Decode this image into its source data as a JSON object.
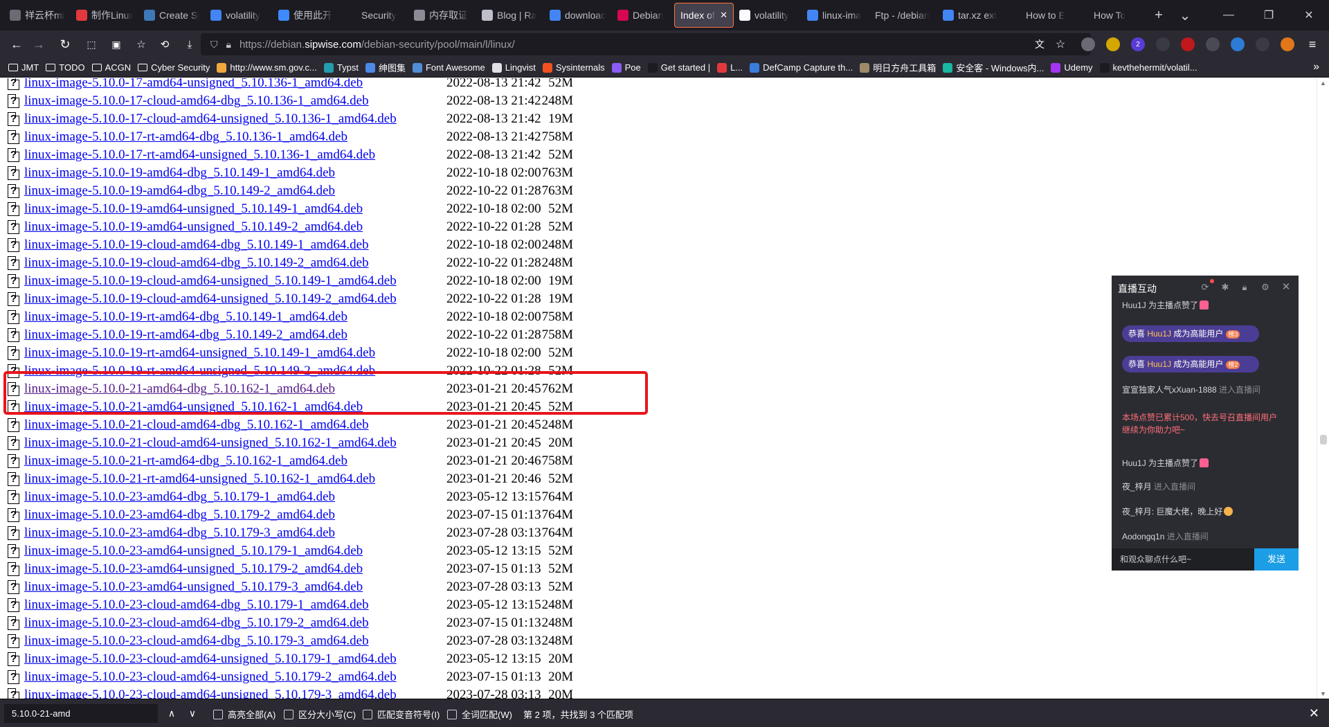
{
  "tabs": [
    {
      "label": "祥云杯mis",
      "icon": "ctf-icon",
      "color": "#6b6b75",
      "active": false
    },
    {
      "label": "制作Linux",
      "icon": "csdn-icon",
      "color": "#e4393c",
      "active": false
    },
    {
      "label": "Create Sp",
      "icon": "wordpress-icon",
      "color": "#3e79b7",
      "active": false
    },
    {
      "label": "volatility",
      "icon": "google-icon",
      "color": "#4285f4",
      "active": false
    },
    {
      "label": "使用此开",
      "icon": "doc-icon",
      "color": "#3d8bfd",
      "active": false
    },
    {
      "label": "Security",
      "icon": "bing-icon",
      "color": "#1c1b22",
      "active": false
    },
    {
      "label": "内存取证",
      "icon": "image-icon",
      "color": "#8c8c96",
      "active": false
    },
    {
      "label": "Blog | Ra",
      "icon": "blog-icon",
      "color": "#bfbfc9",
      "active": false
    },
    {
      "label": "downloac",
      "icon": "google-icon",
      "color": "#4285f4",
      "active": false
    },
    {
      "label": "Debian",
      "icon": "debian-icon",
      "color": "#d70751",
      "active": false
    },
    {
      "label": "Index of /d",
      "icon": "",
      "color": "",
      "active": true
    },
    {
      "label": "volatility",
      "icon": "github-icon",
      "color": "#fbfbfe",
      "active": false
    },
    {
      "label": "linux-ima",
      "icon": "google-icon",
      "color": "#4285f4",
      "active": false
    },
    {
      "label": "Ftp - /debian",
      "icon": "",
      "color": "",
      "active": false
    },
    {
      "label": "tar.xz ext",
      "icon": "google-icon",
      "color": "#4285f4",
      "active": false
    },
    {
      "label": "How to E",
      "icon": "site-icon",
      "color": "#1c1b22",
      "active": false
    },
    {
      "label": "How To",
      "icon": "site-icon",
      "color": "#1c1b22",
      "active": false
    }
  ],
  "address": {
    "prefix": "https://debian.",
    "host": "sipwise.com",
    "path": "/debian-security/pool/main/l/linux/"
  },
  "bookmarks": [
    {
      "label": "JMT",
      "icon": "folder"
    },
    {
      "label": "TODO",
      "icon": "folder"
    },
    {
      "label": "ACGN",
      "icon": "folder"
    },
    {
      "label": "Cyber Security",
      "icon": "folder"
    },
    {
      "label": "http://www.sm.gov.c...",
      "icon": "site",
      "color": "#f2a93b"
    },
    {
      "label": "Typst",
      "icon": "site",
      "color": "#239dad"
    },
    {
      "label": "绅图集",
      "icon": "site",
      "color": "#4d8ae8"
    },
    {
      "label": "Font Awesome",
      "icon": "site",
      "color": "#528dd7"
    },
    {
      "label": "Lingvist",
      "icon": "site",
      "color": "#e0e0e6"
    },
    {
      "label": "Sysinternals",
      "icon": "site",
      "color": "#f25022"
    },
    {
      "label": "Poe",
      "icon": "site",
      "color": "#8b5cf6"
    },
    {
      "label": "Get started |",
      "icon": "site",
      "color": "#1c1b22"
    },
    {
      "label": "L...",
      "icon": "site",
      "color": "#e4393c"
    },
    {
      "label": "DefCamp Capture th...",
      "icon": "site",
      "color": "#3b7ddd"
    },
    {
      "label": "明日方舟工具箱",
      "icon": "site",
      "color": "#9c8a6a"
    },
    {
      "label": "安全客 - Windows内...",
      "icon": "site",
      "color": "#19b6a0"
    },
    {
      "label": "Udemy",
      "icon": "site",
      "color": "#a435f0"
    },
    {
      "label": "kevthehermit/volatil...",
      "icon": "site",
      "color": "#1c1b22"
    }
  ],
  "listing": [
    {
      "name": "linux-image-5.10.0-17-amd64-unsigned_5.10.136-1_amd64.deb",
      "date": "2022-08-13 21:42",
      "size": "52M"
    },
    {
      "name": "linux-image-5.10.0-17-cloud-amd64-dbg_5.10.136-1_amd64.deb",
      "date": "2022-08-13 21:42",
      "size": "248M"
    },
    {
      "name": "linux-image-5.10.0-17-cloud-amd64-unsigned_5.10.136-1_amd64.deb",
      "date": "2022-08-13 21:42",
      "size": "19M"
    },
    {
      "name": "linux-image-5.10.0-17-rt-amd64-dbg_5.10.136-1_amd64.deb",
      "date": "2022-08-13 21:42",
      "size": "758M"
    },
    {
      "name": "linux-image-5.10.0-17-rt-amd64-unsigned_5.10.136-1_amd64.deb",
      "date": "2022-08-13 21:42",
      "size": "52M"
    },
    {
      "name": "linux-image-5.10.0-19-amd64-dbg_5.10.149-1_amd64.deb",
      "date": "2022-10-18 02:00",
      "size": "763M"
    },
    {
      "name": "linux-image-5.10.0-19-amd64-dbg_5.10.149-2_amd64.deb",
      "date": "2022-10-22 01:28",
      "size": "763M"
    },
    {
      "name": "linux-image-5.10.0-19-amd64-unsigned_5.10.149-1_amd64.deb",
      "date": "2022-10-18 02:00",
      "size": "52M"
    },
    {
      "name": "linux-image-5.10.0-19-amd64-unsigned_5.10.149-2_amd64.deb",
      "date": "2022-10-22 01:28",
      "size": "52M"
    },
    {
      "name": "linux-image-5.10.0-19-cloud-amd64-dbg_5.10.149-1_amd64.deb",
      "date": "2022-10-18 02:00",
      "size": "248M"
    },
    {
      "name": "linux-image-5.10.0-19-cloud-amd64-dbg_5.10.149-2_amd64.deb",
      "date": "2022-10-22 01:28",
      "size": "248M"
    },
    {
      "name": "linux-image-5.10.0-19-cloud-amd64-unsigned_5.10.149-1_amd64.deb",
      "date": "2022-10-18 02:00",
      "size": "19M"
    },
    {
      "name": "linux-image-5.10.0-19-cloud-amd64-unsigned_5.10.149-2_amd64.deb",
      "date": "2022-10-22 01:28",
      "size": "19M"
    },
    {
      "name": "linux-image-5.10.0-19-rt-amd64-dbg_5.10.149-1_amd64.deb",
      "date": "2022-10-18 02:00",
      "size": "758M"
    },
    {
      "name": "linux-image-5.10.0-19-rt-amd64-dbg_5.10.149-2_amd64.deb",
      "date": "2022-10-22 01:28",
      "size": "758M"
    },
    {
      "name": "linux-image-5.10.0-19-rt-amd64-unsigned_5.10.149-1_amd64.deb",
      "date": "2022-10-18 02:00",
      "size": "52M"
    },
    {
      "name": "linux-image-5.10.0-19-rt-amd64-unsigned_5.10.149-2_amd64.deb",
      "date": "2022-10-22 01:28",
      "size": "52M"
    },
    {
      "name": "linux-image-5.10.0-21-amd64-dbg_5.10.162-1_amd64.deb",
      "date": "2023-01-21 20:45",
      "size": "762M",
      "visited": true
    },
    {
      "name": "linux-image-5.10.0-21-amd64-unsigned_5.10.162-1_amd64.deb",
      "date": "2023-01-21 20:45",
      "size": "52M"
    },
    {
      "name": "linux-image-5.10.0-21-cloud-amd64-dbg_5.10.162-1_amd64.deb",
      "date": "2023-01-21 20:45",
      "size": "248M"
    },
    {
      "name": "linux-image-5.10.0-21-cloud-amd64-unsigned_5.10.162-1_amd64.deb",
      "date": "2023-01-21 20:45",
      "size": "20M"
    },
    {
      "name": "linux-image-5.10.0-21-rt-amd64-dbg_5.10.162-1_amd64.deb",
      "date": "2023-01-21 20:46",
      "size": "758M"
    },
    {
      "name": "linux-image-5.10.0-21-rt-amd64-unsigned_5.10.162-1_amd64.deb",
      "date": "2023-01-21 20:46",
      "size": "52M"
    },
    {
      "name": "linux-image-5.10.0-23-amd64-dbg_5.10.179-1_amd64.deb",
      "date": "2023-05-12 13:15",
      "size": "764M"
    },
    {
      "name": "linux-image-5.10.0-23-amd64-dbg_5.10.179-2_amd64.deb",
      "date": "2023-07-15 01:13",
      "size": "764M"
    },
    {
      "name": "linux-image-5.10.0-23-amd64-dbg_5.10.179-3_amd64.deb",
      "date": "2023-07-28 03:13",
      "size": "764M"
    },
    {
      "name": "linux-image-5.10.0-23-amd64-unsigned_5.10.179-1_amd64.deb",
      "date": "2023-05-12 13:15",
      "size": "52M"
    },
    {
      "name": "linux-image-5.10.0-23-amd64-unsigned_5.10.179-2_amd64.deb",
      "date": "2023-07-15 01:13",
      "size": "52M"
    },
    {
      "name": "linux-image-5.10.0-23-amd64-unsigned_5.10.179-3_amd64.deb",
      "date": "2023-07-28 03:13",
      "size": "52M"
    },
    {
      "name": "linux-image-5.10.0-23-cloud-amd64-dbg_5.10.179-1_amd64.deb",
      "date": "2023-05-12 13:15",
      "size": "248M"
    },
    {
      "name": "linux-image-5.10.0-23-cloud-amd64-dbg_5.10.179-2_amd64.deb",
      "date": "2023-07-15 01:13",
      "size": "248M"
    },
    {
      "name": "linux-image-5.10.0-23-cloud-amd64-dbg_5.10.179-3_amd64.deb",
      "date": "2023-07-28 03:13",
      "size": "248M"
    },
    {
      "name": "linux-image-5.10.0-23-cloud-amd64-unsigned_5.10.179-1_amd64.deb",
      "date": "2023-05-12 13:15",
      "size": "20M"
    },
    {
      "name": "linux-image-5.10.0-23-cloud-amd64-unsigned_5.10.179-2_amd64.deb",
      "date": "2023-07-15 01:13",
      "size": "20M"
    },
    {
      "name": "linux-image-5.10.0-23-cloud-amd64-unsigned_5.10.179-3_amd64.deb",
      "date": "2023-07-28 03:13",
      "size": "20M"
    }
  ],
  "chat": {
    "title": "直播互动",
    "messages": [
      {
        "kind": "like",
        "name": "Huu1J",
        "text": " 为主播点赞了"
      },
      {
        "kind": "pill",
        "prefix": "恭喜 ",
        "name": "Huu1J",
        "suffix": " 成为高能用户",
        "level": "榜3"
      },
      {
        "kind": "pill",
        "prefix": "恭喜 ",
        "name": "Huu1J",
        "suffix": " 成为高能用户",
        "level": "榜2"
      },
      {
        "kind": "enter",
        "name": "宣宣独家人气xXuan-1888",
        "text": " 进入直播间"
      },
      {
        "kind": "system",
        "text": "本场点赞已累计500，快去号召直播间用户继续为你助力吧~"
      },
      {
        "kind": "like",
        "name": "Huu1J",
        "text": " 为主播点赞了"
      },
      {
        "kind": "enter",
        "name": "夜_梓月",
        "text": " 进入直播间"
      },
      {
        "kind": "chat",
        "name": "夜_梓月",
        "text": ": 巨魔大佬，晚上好"
      },
      {
        "kind": "enter",
        "name": "Aodongq1n",
        "text": " 进入直播间"
      }
    ],
    "input_placeholder": "和观众聊点什么吧~",
    "send_label": "发送"
  },
  "findbar": {
    "query": "5.10.0-21-amd",
    "options": [
      "高亮全部(A)",
      "区分大小写(C)",
      "匹配变音符号(I)",
      "全词匹配(W)"
    ],
    "status": "第 2 项，共找到 3 个匹配项"
  }
}
